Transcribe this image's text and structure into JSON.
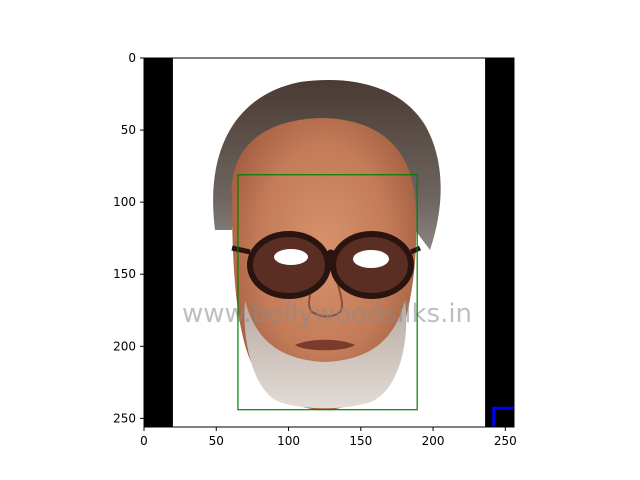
{
  "chart_data": {
    "type": "image",
    "title": "",
    "xlabel": "",
    "ylabel": "",
    "xlim": [
      0,
      256
    ],
    "ylim": [
      256,
      0
    ],
    "y_inverted": true,
    "x_ticks": [
      0,
      50,
      100,
      150,
      200,
      250
    ],
    "y_ticks": [
      0,
      50,
      100,
      150,
      200,
      250
    ],
    "image_content": {
      "black_band_left_x": [
        0,
        20
      ],
      "black_band_right_x": [
        236,
        256
      ],
      "watermark_text": "www.bollywoodsilks.in"
    },
    "annotations": [
      {
        "shape": "rectangle",
        "color": "#008000",
        "x0": 65,
        "y0": 81,
        "x1": 189,
        "y1": 244
      },
      {
        "shape": "corner-bracket",
        "color": "#0000ff",
        "x0": 242,
        "y0": 243,
        "x1": 256,
        "y1": 256
      }
    ],
    "grid": false,
    "legend": "none"
  }
}
